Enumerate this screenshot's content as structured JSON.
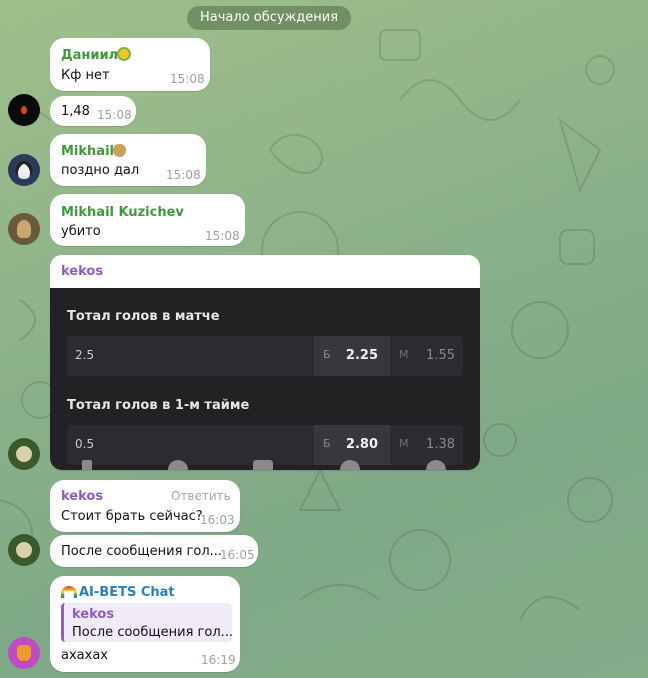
{
  "discussion_pill": "Начало обсуждения",
  "colors": {
    "name_green": "#3f9a3a",
    "name_purple": "#8e5cc9",
    "name_blue": "#2a7fc4",
    "time": "#9aa49a"
  },
  "messages": [
    {
      "author": "Даниил",
      "author_emoji": "sunflower-icon",
      "text": "Кф нет",
      "time": "15:08"
    },
    {
      "text": "1,48",
      "time": "15:08"
    },
    {
      "author": "Mikhail",
      "author_emoji": "money-bag-icon",
      "text": "поздно дал",
      "time": "15:08"
    },
    {
      "author": "Mikhail Kuzichev",
      "text": "убито",
      "time": "15:08"
    },
    {
      "author": "kekos",
      "screenshot": {
        "section1": "Тотал голов в матче",
        "row1": {
          "label": "2.5",
          "b": "Б",
          "b_val": "2.25",
          "m": "М",
          "m_val": "1.55"
        },
        "section2": "Тотал голов в 1-м тайме",
        "row2": {
          "label": "0.5",
          "b": "Б",
          "b_val": "2.80",
          "m": "М",
          "m_val": "1.38"
        }
      }
    },
    {
      "author": "kekos",
      "reply_label": "Ответить",
      "text": "Стоит брать сейчас?",
      "time": "16:03"
    },
    {
      "text": "После сообщения гол...",
      "time": "16:05"
    },
    {
      "author": "AI-BETS Chat",
      "author_emoji": "rainbow-icon",
      "quote": {
        "author": "kekos",
        "text": "После сообщения гол..."
      },
      "text": "ахахах",
      "time": "16:19"
    }
  ]
}
